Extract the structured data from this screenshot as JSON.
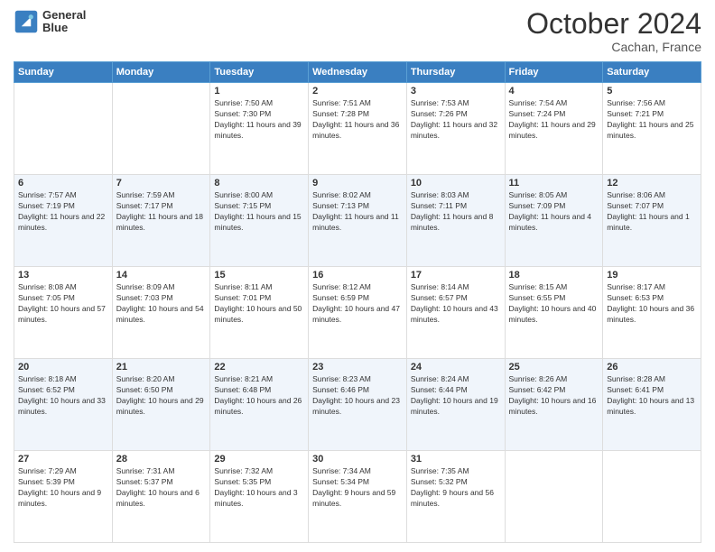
{
  "logo": {
    "line1": "General",
    "line2": "Blue"
  },
  "header": {
    "month": "October 2024",
    "location": "Cachan, France"
  },
  "weekdays": [
    "Sunday",
    "Monday",
    "Tuesday",
    "Wednesday",
    "Thursday",
    "Friday",
    "Saturday"
  ],
  "weeks": [
    [
      {
        "day": "",
        "info": ""
      },
      {
        "day": "",
        "info": ""
      },
      {
        "day": "1",
        "info": "Sunrise: 7:50 AM\nSunset: 7:30 PM\nDaylight: 11 hours and 39 minutes."
      },
      {
        "day": "2",
        "info": "Sunrise: 7:51 AM\nSunset: 7:28 PM\nDaylight: 11 hours and 36 minutes."
      },
      {
        "day": "3",
        "info": "Sunrise: 7:53 AM\nSunset: 7:26 PM\nDaylight: 11 hours and 32 minutes."
      },
      {
        "day": "4",
        "info": "Sunrise: 7:54 AM\nSunset: 7:24 PM\nDaylight: 11 hours and 29 minutes."
      },
      {
        "day": "5",
        "info": "Sunrise: 7:56 AM\nSunset: 7:21 PM\nDaylight: 11 hours and 25 minutes."
      }
    ],
    [
      {
        "day": "6",
        "info": "Sunrise: 7:57 AM\nSunset: 7:19 PM\nDaylight: 11 hours and 22 minutes."
      },
      {
        "day": "7",
        "info": "Sunrise: 7:59 AM\nSunset: 7:17 PM\nDaylight: 11 hours and 18 minutes."
      },
      {
        "day": "8",
        "info": "Sunrise: 8:00 AM\nSunset: 7:15 PM\nDaylight: 11 hours and 15 minutes."
      },
      {
        "day": "9",
        "info": "Sunrise: 8:02 AM\nSunset: 7:13 PM\nDaylight: 11 hours and 11 minutes."
      },
      {
        "day": "10",
        "info": "Sunrise: 8:03 AM\nSunset: 7:11 PM\nDaylight: 11 hours and 8 minutes."
      },
      {
        "day": "11",
        "info": "Sunrise: 8:05 AM\nSunset: 7:09 PM\nDaylight: 11 hours and 4 minutes."
      },
      {
        "day": "12",
        "info": "Sunrise: 8:06 AM\nSunset: 7:07 PM\nDaylight: 11 hours and 1 minute."
      }
    ],
    [
      {
        "day": "13",
        "info": "Sunrise: 8:08 AM\nSunset: 7:05 PM\nDaylight: 10 hours and 57 minutes."
      },
      {
        "day": "14",
        "info": "Sunrise: 8:09 AM\nSunset: 7:03 PM\nDaylight: 10 hours and 54 minutes."
      },
      {
        "day": "15",
        "info": "Sunrise: 8:11 AM\nSunset: 7:01 PM\nDaylight: 10 hours and 50 minutes."
      },
      {
        "day": "16",
        "info": "Sunrise: 8:12 AM\nSunset: 6:59 PM\nDaylight: 10 hours and 47 minutes."
      },
      {
        "day": "17",
        "info": "Sunrise: 8:14 AM\nSunset: 6:57 PM\nDaylight: 10 hours and 43 minutes."
      },
      {
        "day": "18",
        "info": "Sunrise: 8:15 AM\nSunset: 6:55 PM\nDaylight: 10 hours and 40 minutes."
      },
      {
        "day": "19",
        "info": "Sunrise: 8:17 AM\nSunset: 6:53 PM\nDaylight: 10 hours and 36 minutes."
      }
    ],
    [
      {
        "day": "20",
        "info": "Sunrise: 8:18 AM\nSunset: 6:52 PM\nDaylight: 10 hours and 33 minutes."
      },
      {
        "day": "21",
        "info": "Sunrise: 8:20 AM\nSunset: 6:50 PM\nDaylight: 10 hours and 29 minutes."
      },
      {
        "day": "22",
        "info": "Sunrise: 8:21 AM\nSunset: 6:48 PM\nDaylight: 10 hours and 26 minutes."
      },
      {
        "day": "23",
        "info": "Sunrise: 8:23 AM\nSunset: 6:46 PM\nDaylight: 10 hours and 23 minutes."
      },
      {
        "day": "24",
        "info": "Sunrise: 8:24 AM\nSunset: 6:44 PM\nDaylight: 10 hours and 19 minutes."
      },
      {
        "day": "25",
        "info": "Sunrise: 8:26 AM\nSunset: 6:42 PM\nDaylight: 10 hours and 16 minutes."
      },
      {
        "day": "26",
        "info": "Sunrise: 8:28 AM\nSunset: 6:41 PM\nDaylight: 10 hours and 13 minutes."
      }
    ],
    [
      {
        "day": "27",
        "info": "Sunrise: 7:29 AM\nSunset: 5:39 PM\nDaylight: 10 hours and 9 minutes."
      },
      {
        "day": "28",
        "info": "Sunrise: 7:31 AM\nSunset: 5:37 PM\nDaylight: 10 hours and 6 minutes."
      },
      {
        "day": "29",
        "info": "Sunrise: 7:32 AM\nSunset: 5:35 PM\nDaylight: 10 hours and 3 minutes."
      },
      {
        "day": "30",
        "info": "Sunrise: 7:34 AM\nSunset: 5:34 PM\nDaylight: 9 hours and 59 minutes."
      },
      {
        "day": "31",
        "info": "Sunrise: 7:35 AM\nSunset: 5:32 PM\nDaylight: 9 hours and 56 minutes."
      },
      {
        "day": "",
        "info": ""
      },
      {
        "day": "",
        "info": ""
      }
    ]
  ]
}
